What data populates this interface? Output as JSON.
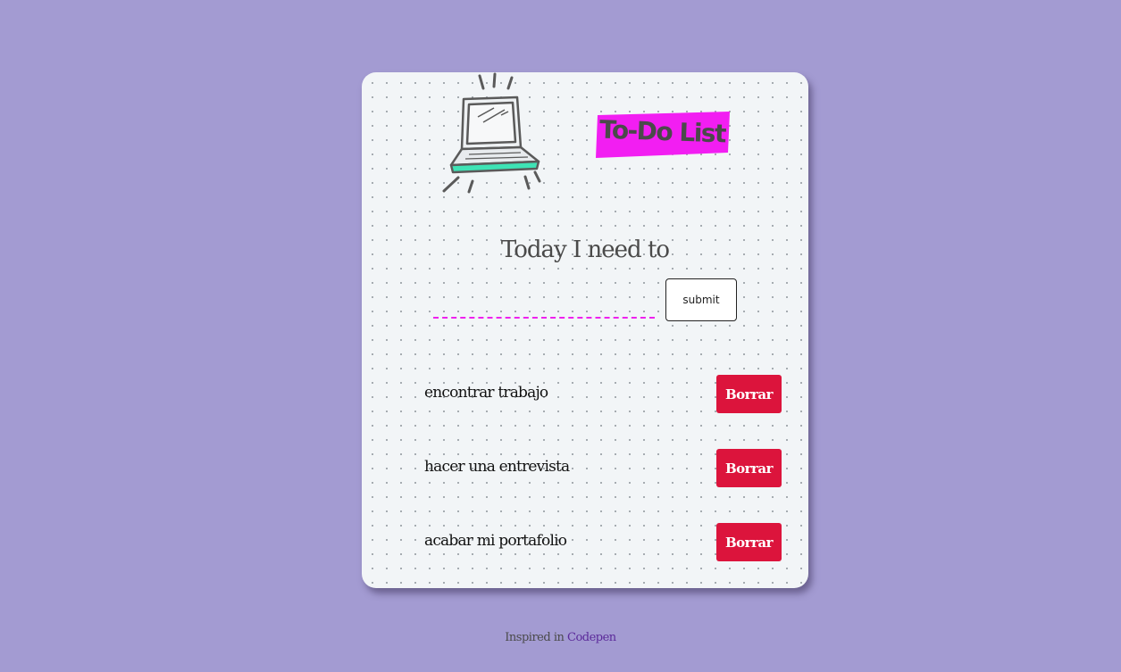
{
  "header": {
    "title": "To-Do List",
    "illustration_icon": "laptop-icon",
    "title_highlight_color": "#f21ef2"
  },
  "form": {
    "heading": "Today I need to",
    "input_value": "",
    "input_placeholder": "",
    "submit_label": "submit",
    "input_underline_color": "#ee22ee"
  },
  "tasks": [
    {
      "text": "encontrar trabajo",
      "delete_label": "Borrar"
    },
    {
      "text": "hacer una entrevista",
      "delete_label": "Borrar"
    },
    {
      "text": "acabar mi portafolio",
      "delete_label": "Borrar"
    }
  ],
  "footer": {
    "prefix": "Inspired in",
    "link_text": "Codepen"
  },
  "colors": {
    "page_background": "#a39bd2",
    "card_background": "#f2f5f7",
    "delete_button": "#dc143c",
    "laptop_accent": "#3ee3b5",
    "footer_link": "#5b2a9a"
  }
}
